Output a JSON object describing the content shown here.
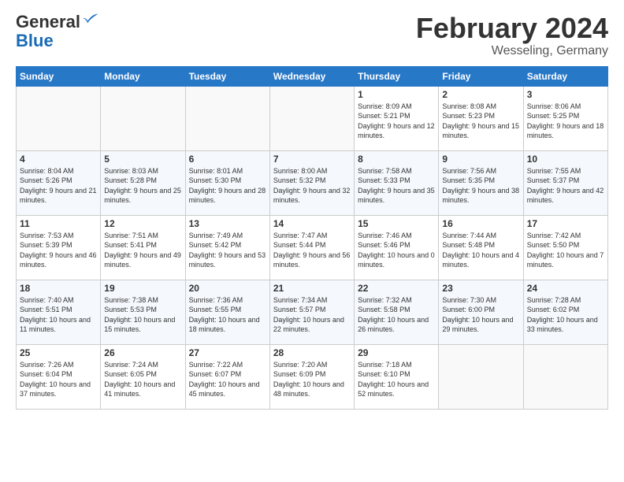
{
  "header": {
    "logo_general": "General",
    "logo_blue": "Blue",
    "month_title": "February 2024",
    "location": "Wesseling, Germany"
  },
  "weekdays": [
    "Sunday",
    "Monday",
    "Tuesday",
    "Wednesday",
    "Thursday",
    "Friday",
    "Saturday"
  ],
  "weeks": [
    [
      {
        "day": "",
        "sunrise": "",
        "sunset": "",
        "daylight": ""
      },
      {
        "day": "",
        "sunrise": "",
        "sunset": "",
        "daylight": ""
      },
      {
        "day": "",
        "sunrise": "",
        "sunset": "",
        "daylight": ""
      },
      {
        "day": "",
        "sunrise": "",
        "sunset": "",
        "daylight": ""
      },
      {
        "day": "1",
        "sunrise": "Sunrise: 8:09 AM",
        "sunset": "Sunset: 5:21 PM",
        "daylight": "Daylight: 9 hours and 12 minutes."
      },
      {
        "day": "2",
        "sunrise": "Sunrise: 8:08 AM",
        "sunset": "Sunset: 5:23 PM",
        "daylight": "Daylight: 9 hours and 15 minutes."
      },
      {
        "day": "3",
        "sunrise": "Sunrise: 8:06 AM",
        "sunset": "Sunset: 5:25 PM",
        "daylight": "Daylight: 9 hours and 18 minutes."
      }
    ],
    [
      {
        "day": "4",
        "sunrise": "Sunrise: 8:04 AM",
        "sunset": "Sunset: 5:26 PM",
        "daylight": "Daylight: 9 hours and 21 minutes."
      },
      {
        "day": "5",
        "sunrise": "Sunrise: 8:03 AM",
        "sunset": "Sunset: 5:28 PM",
        "daylight": "Daylight: 9 hours and 25 minutes."
      },
      {
        "day": "6",
        "sunrise": "Sunrise: 8:01 AM",
        "sunset": "Sunset: 5:30 PM",
        "daylight": "Daylight: 9 hours and 28 minutes."
      },
      {
        "day": "7",
        "sunrise": "Sunrise: 8:00 AM",
        "sunset": "Sunset: 5:32 PM",
        "daylight": "Daylight: 9 hours and 32 minutes."
      },
      {
        "day": "8",
        "sunrise": "Sunrise: 7:58 AM",
        "sunset": "Sunset: 5:33 PM",
        "daylight": "Daylight: 9 hours and 35 minutes."
      },
      {
        "day": "9",
        "sunrise": "Sunrise: 7:56 AM",
        "sunset": "Sunset: 5:35 PM",
        "daylight": "Daylight: 9 hours and 38 minutes."
      },
      {
        "day": "10",
        "sunrise": "Sunrise: 7:55 AM",
        "sunset": "Sunset: 5:37 PM",
        "daylight": "Daylight: 9 hours and 42 minutes."
      }
    ],
    [
      {
        "day": "11",
        "sunrise": "Sunrise: 7:53 AM",
        "sunset": "Sunset: 5:39 PM",
        "daylight": "Daylight: 9 hours and 46 minutes."
      },
      {
        "day": "12",
        "sunrise": "Sunrise: 7:51 AM",
        "sunset": "Sunset: 5:41 PM",
        "daylight": "Daylight: 9 hours and 49 minutes."
      },
      {
        "day": "13",
        "sunrise": "Sunrise: 7:49 AM",
        "sunset": "Sunset: 5:42 PM",
        "daylight": "Daylight: 9 hours and 53 minutes."
      },
      {
        "day": "14",
        "sunrise": "Sunrise: 7:47 AM",
        "sunset": "Sunset: 5:44 PM",
        "daylight": "Daylight: 9 hours and 56 minutes."
      },
      {
        "day": "15",
        "sunrise": "Sunrise: 7:46 AM",
        "sunset": "Sunset: 5:46 PM",
        "daylight": "Daylight: 10 hours and 0 minutes."
      },
      {
        "day": "16",
        "sunrise": "Sunrise: 7:44 AM",
        "sunset": "Sunset: 5:48 PM",
        "daylight": "Daylight: 10 hours and 4 minutes."
      },
      {
        "day": "17",
        "sunrise": "Sunrise: 7:42 AM",
        "sunset": "Sunset: 5:50 PM",
        "daylight": "Daylight: 10 hours and 7 minutes."
      }
    ],
    [
      {
        "day": "18",
        "sunrise": "Sunrise: 7:40 AM",
        "sunset": "Sunset: 5:51 PM",
        "daylight": "Daylight: 10 hours and 11 minutes."
      },
      {
        "day": "19",
        "sunrise": "Sunrise: 7:38 AM",
        "sunset": "Sunset: 5:53 PM",
        "daylight": "Daylight: 10 hours and 15 minutes."
      },
      {
        "day": "20",
        "sunrise": "Sunrise: 7:36 AM",
        "sunset": "Sunset: 5:55 PM",
        "daylight": "Daylight: 10 hours and 18 minutes."
      },
      {
        "day": "21",
        "sunrise": "Sunrise: 7:34 AM",
        "sunset": "Sunset: 5:57 PM",
        "daylight": "Daylight: 10 hours and 22 minutes."
      },
      {
        "day": "22",
        "sunrise": "Sunrise: 7:32 AM",
        "sunset": "Sunset: 5:58 PM",
        "daylight": "Daylight: 10 hours and 26 minutes."
      },
      {
        "day": "23",
        "sunrise": "Sunrise: 7:30 AM",
        "sunset": "Sunset: 6:00 PM",
        "daylight": "Daylight: 10 hours and 29 minutes."
      },
      {
        "day": "24",
        "sunrise": "Sunrise: 7:28 AM",
        "sunset": "Sunset: 6:02 PM",
        "daylight": "Daylight: 10 hours and 33 minutes."
      }
    ],
    [
      {
        "day": "25",
        "sunrise": "Sunrise: 7:26 AM",
        "sunset": "Sunset: 6:04 PM",
        "daylight": "Daylight: 10 hours and 37 minutes."
      },
      {
        "day": "26",
        "sunrise": "Sunrise: 7:24 AM",
        "sunset": "Sunset: 6:05 PM",
        "daylight": "Daylight: 10 hours and 41 minutes."
      },
      {
        "day": "27",
        "sunrise": "Sunrise: 7:22 AM",
        "sunset": "Sunset: 6:07 PM",
        "daylight": "Daylight: 10 hours and 45 minutes."
      },
      {
        "day": "28",
        "sunrise": "Sunrise: 7:20 AM",
        "sunset": "Sunset: 6:09 PM",
        "daylight": "Daylight: 10 hours and 48 minutes."
      },
      {
        "day": "29",
        "sunrise": "Sunrise: 7:18 AM",
        "sunset": "Sunset: 6:10 PM",
        "daylight": "Daylight: 10 hours and 52 minutes."
      },
      {
        "day": "",
        "sunrise": "",
        "sunset": "",
        "daylight": ""
      },
      {
        "day": "",
        "sunrise": "",
        "sunset": "",
        "daylight": ""
      }
    ]
  ]
}
